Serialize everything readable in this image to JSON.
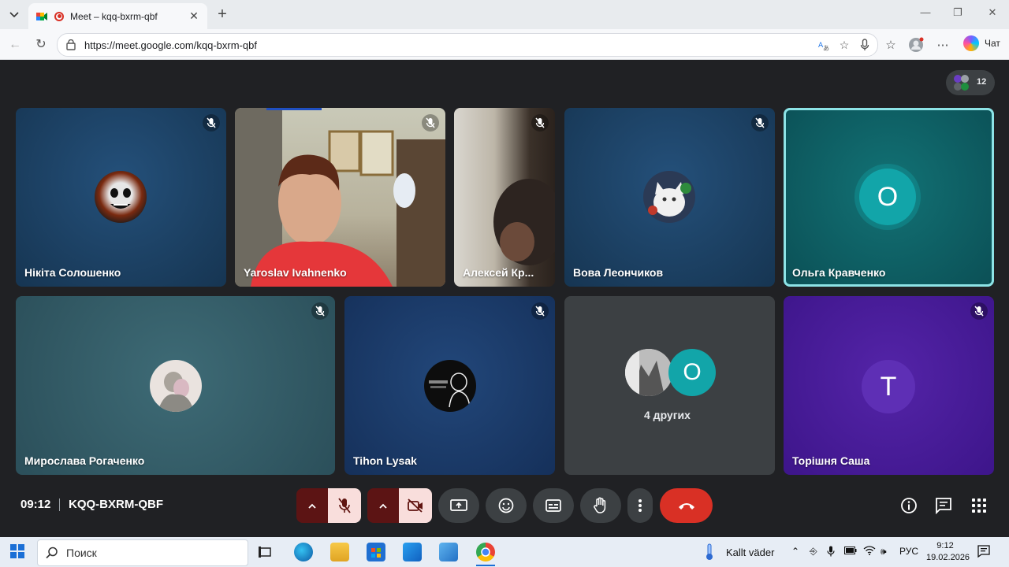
{
  "browser": {
    "tab_title": "Meet – kqq-bxrm-qbf",
    "url": "https://meet.google.com/kqq-bxrm-qbf",
    "chat_label": "Чат"
  },
  "meet": {
    "participant_count": "12",
    "tiles": [
      {
        "name": "Нікіта Солошенко"
      },
      {
        "name": "Yaroslav Ivahnenko"
      },
      {
        "name": "Алексей Кр..."
      },
      {
        "name": "Вова Леончиков"
      },
      {
        "name": "Ольга Кравченко",
        "initial": "О"
      },
      {
        "name": "Мирослава Рогаченко"
      },
      {
        "name": "Tihon Lysak"
      },
      {
        "others_label": "4 других",
        "initial": "О"
      },
      {
        "name": "Торішня Саша",
        "initial": "T"
      }
    ],
    "clock": "09:12",
    "meeting_code": "KQQ-BXRM-QBF"
  },
  "taskbar": {
    "search_placeholder": "Поиск",
    "weather": "Kallt väder",
    "language": "РУС",
    "time": "9:12",
    "date": "19.02.2026"
  },
  "colors": {
    "accent_teal": "#12a5a9",
    "end_call": "#d93025",
    "tile_blue": "#1c3d5e",
    "tile_purple": "#4a1c98"
  }
}
